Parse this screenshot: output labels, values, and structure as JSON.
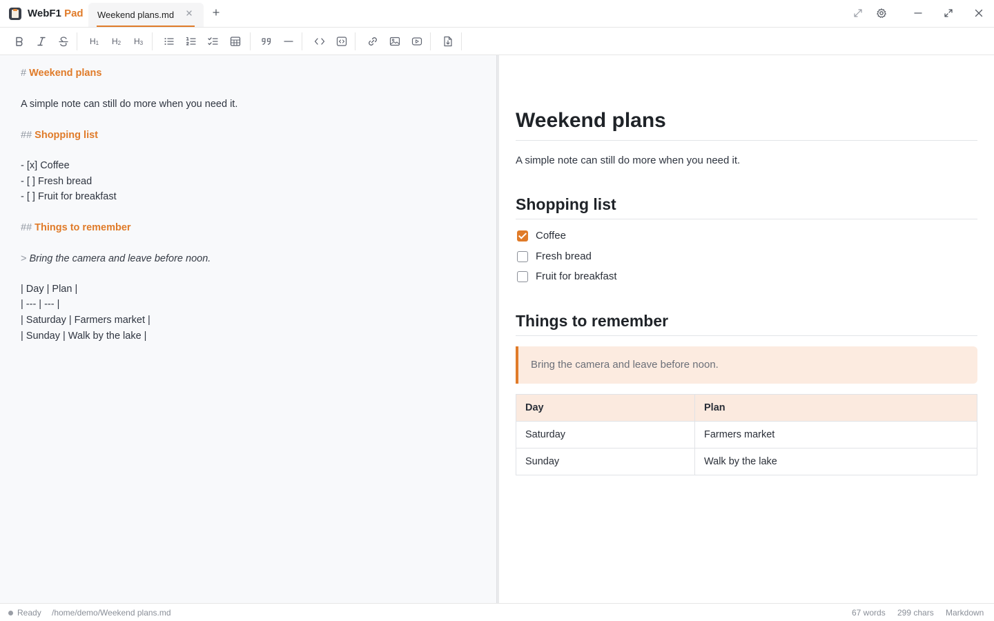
{
  "app": {
    "name": "WebF1",
    "name_accent": "Pad",
    "logo_icon": "notepad-icon"
  },
  "tabs": [
    {
      "label": "Weekend plans.md",
      "active": true
    }
  ],
  "window_controls": [
    "fullscreen-icon",
    "gear-icon",
    "minimize-icon",
    "maximize-icon",
    "close-icon"
  ],
  "toolbar": {
    "h1": "H",
    "h1_sub": "1",
    "h2": "H",
    "h2_sub": "2",
    "h3": "H",
    "h3_sub": "3"
  },
  "editor": {
    "l1_mark": "#",
    "l1_text": "Weekend plans",
    "l2": "A simple note can still do more when you need it.",
    "l3_mark": "##",
    "l3_text": "Shopping list",
    "l4": "- [x] Coffee",
    "l5": "- [ ] Fresh bread",
    "l6": "- [ ] Fruit for breakfast",
    "l7_mark": "##",
    "l7_text": "Things to remember",
    "l8_mark": ">",
    "l8_text": "Bring the camera and leave before noon.",
    "l9": "| Day | Plan |",
    "l10": "| --- | --- |",
    "l11": "| Saturday | Farmers market |",
    "l12": "| Sunday | Walk by the lake |"
  },
  "preview": {
    "title": "Weekend plans",
    "intro": "A simple note can still do more when you need it.",
    "shopping_heading": "Shopping list",
    "tasks": [
      {
        "label": "Coffee",
        "checked": true
      },
      {
        "label": "Fresh bread",
        "checked": false
      },
      {
        "label": "Fruit for breakfast",
        "checked": false
      }
    ],
    "remember_heading": "Things to remember",
    "quote": "Bring the camera and leave before noon.",
    "table": {
      "headers": [
        "Day",
        "Plan"
      ],
      "rows": [
        [
          "Saturday",
          "Farmers market"
        ],
        [
          "Sunday",
          "Walk by the lake"
        ]
      ]
    }
  },
  "status": {
    "state": "Ready",
    "path": "/home/demo/Weekend plans.md",
    "words": "67 words",
    "chars": "299 chars",
    "mode": "Markdown"
  },
  "colors": {
    "accent": "#e07b29",
    "quote_bg": "#fcebe0",
    "editor_bg": "#f8f9fb"
  }
}
